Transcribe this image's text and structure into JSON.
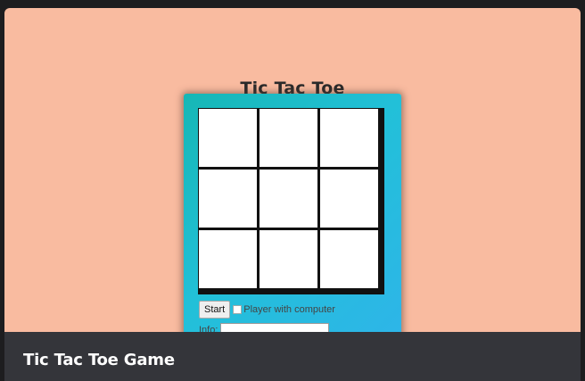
{
  "game": {
    "title": "Tic Tac Toe",
    "board": [
      "",
      "",
      "",
      "",
      "",
      "",
      "",
      "",
      ""
    ],
    "start_label": "Start",
    "computer_checkbox_label": "Player with computer",
    "computer_checkbox_checked": false,
    "info_label": "Info:",
    "info_value": ""
  },
  "caption": {
    "title": "Tic Tac Toe Game"
  },
  "colors": {
    "background": "#f9bba0",
    "panel_gradient_start": "#16b7b5",
    "panel_gradient_end": "#2fb4ea",
    "caption_bar": "#34353a"
  }
}
